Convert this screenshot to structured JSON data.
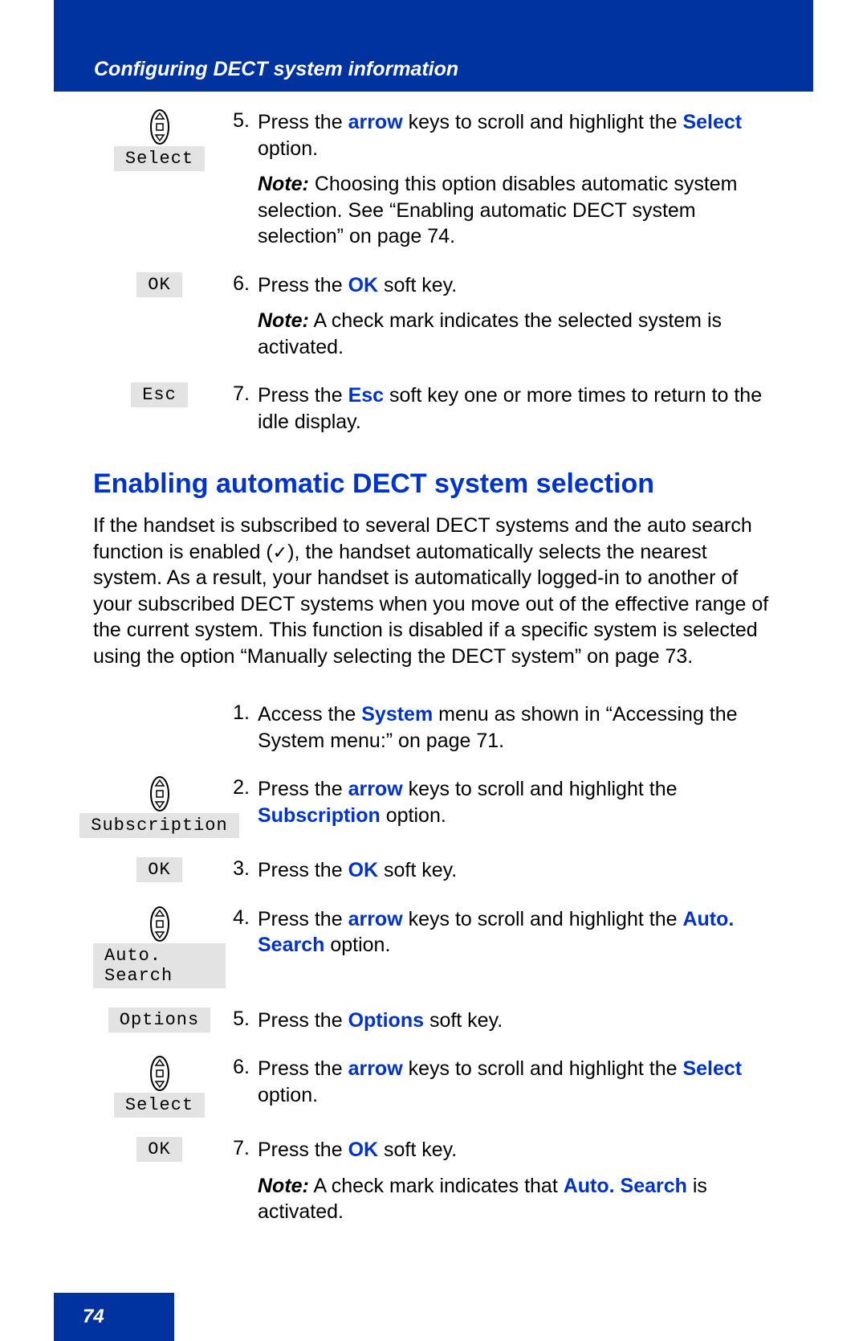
{
  "header": "Configuring DECT system information",
  "steps_a": [
    {
      "num": "5.",
      "icon": {
        "type": "nav",
        "label": "Select"
      },
      "lines": [
        {
          "segments": [
            {
              "t": "Press the "
            },
            {
              "t": "arrow",
              "kw": true
            },
            {
              "t": " keys to scroll and highlight the "
            },
            {
              "t": "Select",
              "kw": true
            },
            {
              "t": " option."
            }
          ]
        },
        {
          "segments": [
            {
              "t": "Note:",
              "note": true
            },
            {
              "t": " Choosing this option disables automatic system selection. See “Enabling automatic DECT system selection” on page 74."
            }
          ]
        }
      ]
    },
    {
      "num": "6.",
      "icon": {
        "type": "key",
        "label": "OK"
      },
      "lines": [
        {
          "segments": [
            {
              "t": "Press the "
            },
            {
              "t": "OK",
              "kw": true
            },
            {
              "t": " soft key."
            }
          ]
        },
        {
          "segments": [
            {
              "t": "Note:",
              "note": true
            },
            {
              "t": " A check mark indicates the selected system is activated."
            }
          ]
        }
      ]
    },
    {
      "num": "7.",
      "icon": {
        "type": "key",
        "label": "Esc"
      },
      "lines": [
        {
          "segments": [
            {
              "t": "Press the "
            },
            {
              "t": "Esc",
              "kw": true
            },
            {
              "t": " soft key one or more times to return to the idle display."
            }
          ]
        }
      ]
    }
  ],
  "heading": "Enabling automatic DECT system selection",
  "paragraph_segments": [
    {
      "t": "If the handset is subscribed to several DECT systems and the auto search function is enabled ("
    },
    {
      "t": "✓",
      "check": true
    },
    {
      "t": "), the handset automatically selects the nearest system. As a result, your handset is automatically logged-in to another of your subscribed DECT systems when you move out of the effective range of the current system. This function is disabled if a specific system is selected using the option “Manually selecting the DECT system” on page 73."
    }
  ],
  "steps_b": [
    {
      "num": "1.",
      "icon": null,
      "lines": [
        {
          "segments": [
            {
              "t": "Access the "
            },
            {
              "t": "System",
              "kw": true
            },
            {
              "t": " menu as shown in “Accessing the System menu:” on page 71."
            }
          ]
        }
      ]
    },
    {
      "num": "2.",
      "icon": {
        "type": "nav",
        "label": "Subscription"
      },
      "lines": [
        {
          "segments": [
            {
              "t": "Press the "
            },
            {
              "t": "arrow",
              "kw": true
            },
            {
              "t": " keys to scroll and highlight the "
            },
            {
              "t": "Subscription",
              "kw": true
            },
            {
              "t": " option."
            }
          ]
        }
      ]
    },
    {
      "num": "3.",
      "icon": {
        "type": "key",
        "label": "OK"
      },
      "lines": [
        {
          "segments": [
            {
              "t": "Press the "
            },
            {
              "t": "OK",
              "kw": true
            },
            {
              "t": " soft key."
            }
          ]
        }
      ]
    },
    {
      "num": "4.",
      "icon": {
        "type": "nav",
        "label": "Auto. Search"
      },
      "lines": [
        {
          "segments": [
            {
              "t": "Press the "
            },
            {
              "t": "arrow",
              "kw": true
            },
            {
              "t": " keys to scroll and highlight the "
            },
            {
              "t": "Auto. Search",
              "kw": true
            },
            {
              "t": " option."
            }
          ]
        }
      ]
    },
    {
      "num": "5.",
      "icon": {
        "type": "key",
        "label": "Options"
      },
      "lines": [
        {
          "segments": [
            {
              "t": "Press the "
            },
            {
              "t": "Options",
              "kw": true
            },
            {
              "t": " soft key."
            }
          ]
        }
      ]
    },
    {
      "num": "6.",
      "icon": {
        "type": "nav",
        "label": "Select"
      },
      "lines": [
        {
          "segments": [
            {
              "t": "Press the "
            },
            {
              "t": "arrow",
              "kw": true
            },
            {
              "t": " keys to scroll and highlight the "
            },
            {
              "t": "Select",
              "kw": true
            },
            {
              "t": " option."
            }
          ]
        }
      ]
    },
    {
      "num": "7.",
      "icon": {
        "type": "key",
        "label": "OK"
      },
      "lines": [
        {
          "segments": [
            {
              "t": "Press the "
            },
            {
              "t": "OK",
              "kw": true
            },
            {
              "t": " soft key."
            }
          ]
        },
        {
          "segments": [
            {
              "t": "Note:",
              "note": true
            },
            {
              "t": " A check mark indicates that "
            },
            {
              "t": "Auto. Search",
              "kw": true
            },
            {
              "t": " is activated."
            }
          ]
        }
      ]
    }
  ],
  "page_number": "74"
}
